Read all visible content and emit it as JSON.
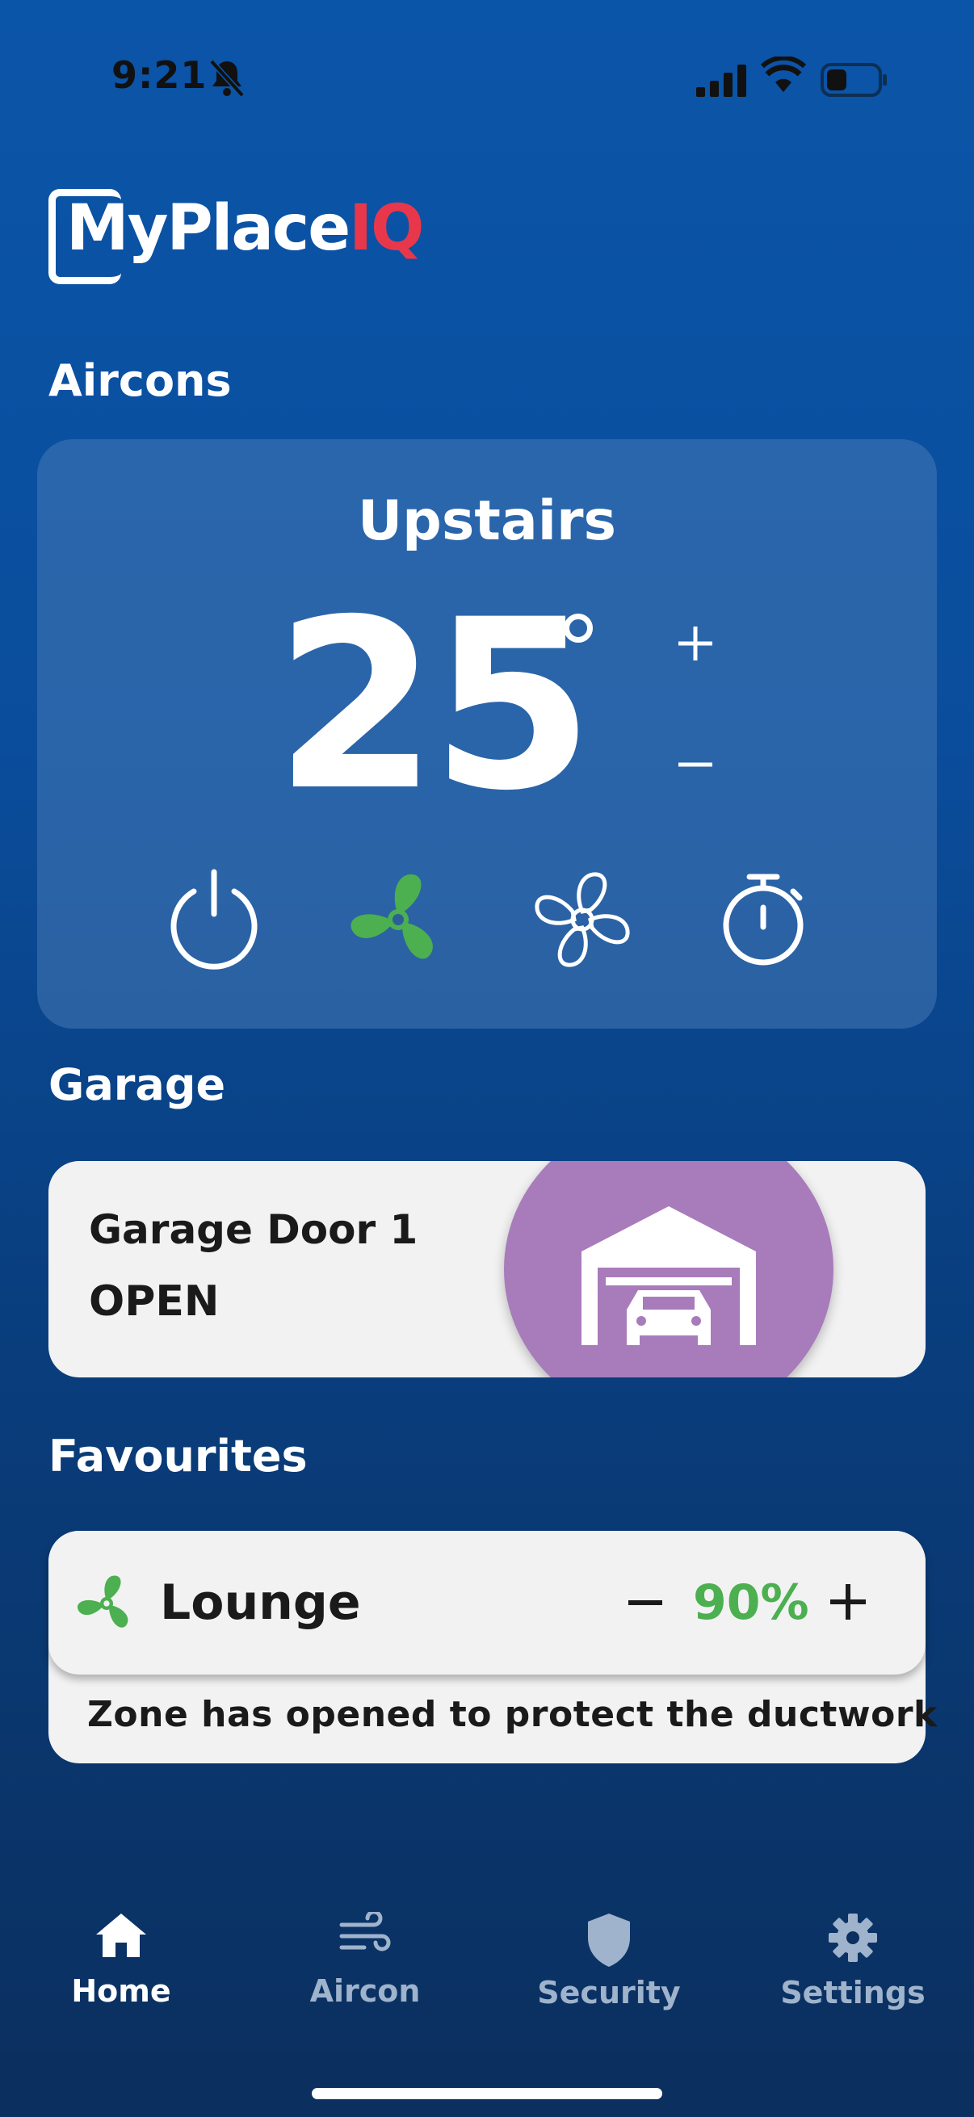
{
  "status_bar": {
    "time": "9:21"
  },
  "logo": {
    "text_main": "MyPlace",
    "text_accent": "IQ"
  },
  "sections": {
    "aircons": "Aircons",
    "garage": "Garage",
    "favourites": "Favourites"
  },
  "aircon": {
    "name": "Upstairs",
    "temperature": "25",
    "mode_color_active": "#4caf50",
    "controls": [
      "power-icon",
      "fan-active-icon",
      "fan-icon",
      "timer-icon"
    ]
  },
  "garage": {
    "name": "Garage Door 1",
    "status": "OPEN",
    "accent": "#a87cbb"
  },
  "favourite": {
    "name": "Lounge",
    "value": "90%",
    "note": "Zone has opened to protect the ductwork"
  },
  "nav": {
    "items": [
      {
        "label": "Home",
        "icon": "home-icon",
        "active": true
      },
      {
        "label": "Aircon",
        "icon": "wind-icon",
        "active": false
      },
      {
        "label": "Security",
        "icon": "shield-icon",
        "active": false
      },
      {
        "label": "Settings",
        "icon": "gear-icon",
        "active": false
      }
    ]
  }
}
